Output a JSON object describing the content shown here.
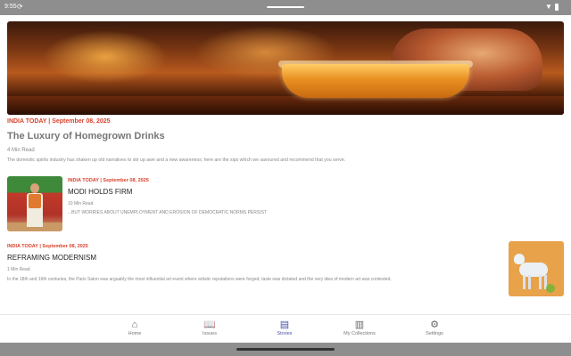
{
  "status_bar": {
    "time": "9:55",
    "sync_icon": "sync-icon",
    "wifi_icon": "wifi-icon",
    "battery_icon": "battery-icon"
  },
  "featured": {
    "image_icon": "drink-bowl-image",
    "meta": "INDIA TODAY | September 08,  2025",
    "title": "The Luxury of Homegrown Drinks",
    "read_time": "4 Min Read",
    "description": "The domestic spirits industry has shaken up old narratives to stir up awe and a new awareness; here are the sips which we savoured and recommend that you serve."
  },
  "articles": [
    {
      "meta": "INDIA TODAY | September 08,  2025",
      "title": "MODI HOLDS FIRM",
      "read_time": "10 Min Read",
      "description": "...BUT WORRIES ABOUT UNEMPLOYMENT AND EROSION OF DEMOCRATIC NORMS PERSIST"
    },
    {
      "meta": "INDIA TODAY | September 08,  2025",
      "title": "REFRAMING MODERNISM",
      "read_time": "1 Min Read",
      "description": "In the 18th and 19th centuries, the Paris Salon was arguably the most influential art event where artistic reputations were forged, taste was dictated and the very idea of modern art was contested."
    }
  ],
  "nav": {
    "items": [
      {
        "label": "Home",
        "icon": "home-icon"
      },
      {
        "label": "Issues",
        "icon": "book-icon"
      },
      {
        "label": "Stories",
        "icon": "document-icon"
      },
      {
        "label": "My Collections",
        "icon": "library-icon"
      },
      {
        "label": "Settings",
        "icon": "gear-icon"
      }
    ],
    "active": "Stories"
  },
  "colors": {
    "accent_red": "#d9432d",
    "active_nav": "#4a55a8",
    "system_bar": "#8e8e8e"
  }
}
